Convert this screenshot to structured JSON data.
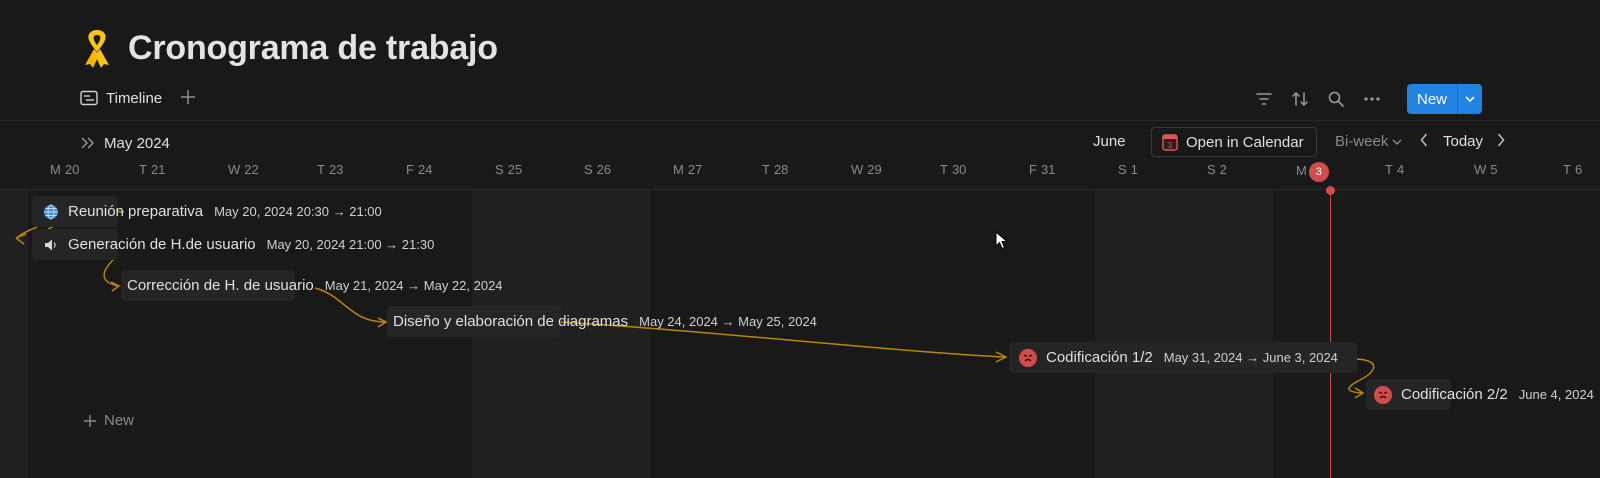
{
  "page": {
    "title": "Cronograma de trabajo",
    "icon": "yellow-ribbon-icon"
  },
  "views": {
    "active_tab": "Timeline",
    "add_icon": "plus-icon"
  },
  "toolbar": {
    "new_label": "New"
  },
  "timeline": {
    "month_label": "May 2024",
    "next_month_label": "June",
    "open_calendar_label": "Open in Calendar",
    "calendar_icon_number": "3",
    "scale": "Bi-week",
    "today_label": "Today",
    "days": [
      {
        "d": "M",
        "n": "20"
      },
      {
        "d": "T",
        "n": "21"
      },
      {
        "d": "W",
        "n": "22"
      },
      {
        "d": "T",
        "n": "23"
      },
      {
        "d": "F",
        "n": "24"
      },
      {
        "d": "S",
        "n": "25"
      },
      {
        "d": "S",
        "n": "26"
      },
      {
        "d": "M",
        "n": "27"
      },
      {
        "d": "T",
        "n": "28"
      },
      {
        "d": "W",
        "n": "29"
      },
      {
        "d": "T",
        "n": "30"
      },
      {
        "d": "F",
        "n": "31"
      },
      {
        "d": "S",
        "n": "1"
      },
      {
        "d": "S",
        "n": "2"
      },
      {
        "d": "M",
        "n": "3"
      },
      {
        "d": "T",
        "n": "4"
      },
      {
        "d": "W",
        "n": "5"
      },
      {
        "d": "T",
        "n": "6"
      }
    ],
    "today_number": "3"
  },
  "tasks": [
    {
      "name": "Reunión preparativa",
      "dates": "May 20, 2024 20:30 → 21:00",
      "icon": "globe-icon"
    },
    {
      "name": "Generación de H.de usuario",
      "dates": "May 20, 2024 21:00 → 21:30",
      "icon": "speaker-icon"
    },
    {
      "name": "Corrección de H. de usuario",
      "dates": "May 21, 2024 → May 22, 2024",
      "icon": ""
    },
    {
      "name": "Diseño y elaboración de diagramas",
      "dates": "May 24, 2024 → May 25, 2024",
      "icon": ""
    },
    {
      "name": "Codificación 1/2",
      "dates": "May 31, 2024 → June 3, 2024",
      "icon": "angry-face-icon"
    },
    {
      "name": "Codificación 2/2",
      "dates": "June 4, 2024",
      "icon": "angry-face-icon"
    }
  ],
  "footer": {
    "new_label": "New"
  },
  "colors": {
    "background": "#191919",
    "accent": "#2383e2",
    "today": "#d24c4c",
    "dependency": "#b8860b",
    "ribbon": "#f5c518"
  }
}
